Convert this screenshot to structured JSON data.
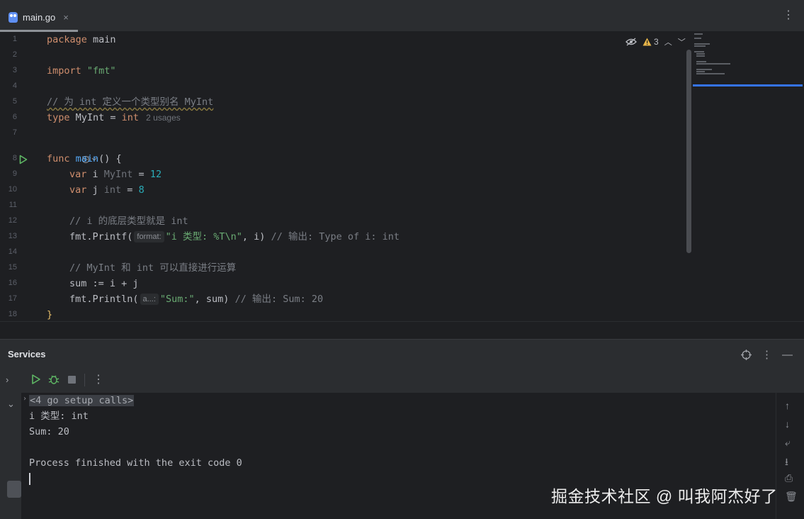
{
  "tab": {
    "filename": "main.go",
    "close_glyph": "×"
  },
  "tab_menu_icon": "more-vert-icon",
  "editor": {
    "line_numbers": [
      "1",
      "2",
      "3",
      "4",
      "5",
      "6",
      "7",
      "8",
      "9",
      "10",
      "11",
      "12",
      "13",
      "14",
      "15",
      "16",
      "17",
      "18"
    ],
    "inspection": {
      "warnings_count": "3"
    },
    "line1": {
      "kw": "package",
      "rest": " main"
    },
    "line3": {
      "kw": "import",
      "str": "\"fmt\""
    },
    "line5": {
      "comment": "// 为 int 定义一个类型别名 MyInt"
    },
    "line6": {
      "kw": "type",
      "name": " MyInt = ",
      "ty": "int",
      "usages": "2 usages"
    },
    "line8": {
      "kw": "func",
      "fn": "main",
      "rest": "() {"
    },
    "line9": {
      "kw": "var",
      "name": " i ",
      "ty": "MyInt",
      "eq": " = ",
      "num": "12"
    },
    "line10": {
      "kw": "var",
      "name": " j ",
      "ty": "int",
      "eq": " = ",
      "num": "8"
    },
    "line12": {
      "comment": "// i 的底层类型就是 int"
    },
    "line13": {
      "call": "fmt.Printf(",
      "hint": "format:",
      "str": "\"i 类型: %T\\n\"",
      "rest": ", i)",
      "comment": " // 输出: Type of i: int"
    },
    "line15": {
      "comment": "// MyInt 和 int 可以直接进行运算"
    },
    "line16": {
      "code": "sum := i + j"
    },
    "line17": {
      "call": "fmt.Println(",
      "hint": "a...:",
      "str": "\"Sum:\"",
      "rest": ", sum)",
      "comment": " // 输出: Sum: 20"
    },
    "line18": {
      "code": "}"
    }
  },
  "services": {
    "title": "Services",
    "console": {
      "setup_calls": "<4 go setup calls>",
      "lines": [
        "i 类型: int",
        "Sum: 20",
        "",
        "Process finished with the exit code 0"
      ]
    }
  },
  "watermark": "掘金技术社区 @ 叫我阿杰好了",
  "colors": {
    "keyword": "#cf8e6d",
    "function": "#56a8f5",
    "string": "#6aab73",
    "number": "#2aacb8",
    "comment": "#7a7e85",
    "run": "#5fb865"
  }
}
